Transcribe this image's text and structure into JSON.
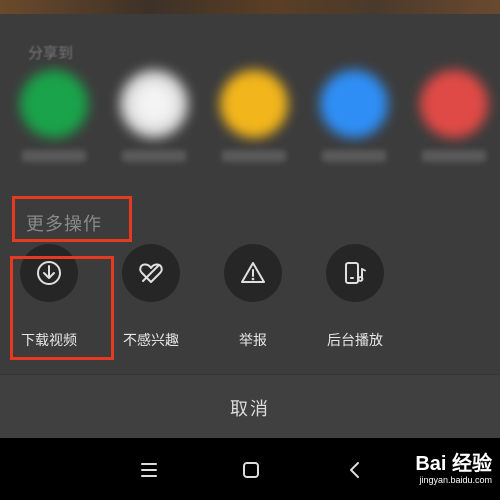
{
  "share_section": {
    "title": "分享到"
  },
  "more_section": {
    "title": "更多操作"
  },
  "actions": [
    {
      "label": "下载视频",
      "icon": "download-icon"
    },
    {
      "label": "不感兴趣",
      "icon": "heart-slash-icon"
    },
    {
      "label": "举报",
      "icon": "warning-icon"
    },
    {
      "label": "后台播放",
      "icon": "background-play-icon"
    }
  ],
  "cancel": {
    "label": "取消"
  },
  "watermark": {
    "brand": "Bai 经验",
    "url": "jingyan.baidu.com"
  },
  "colors": {
    "highlight": "#e53a1f",
    "share_app_colors": [
      "#1aa34a",
      "#e8e8e8",
      "#f2b51c",
      "#2f8ef5",
      "#e04a46"
    ]
  }
}
